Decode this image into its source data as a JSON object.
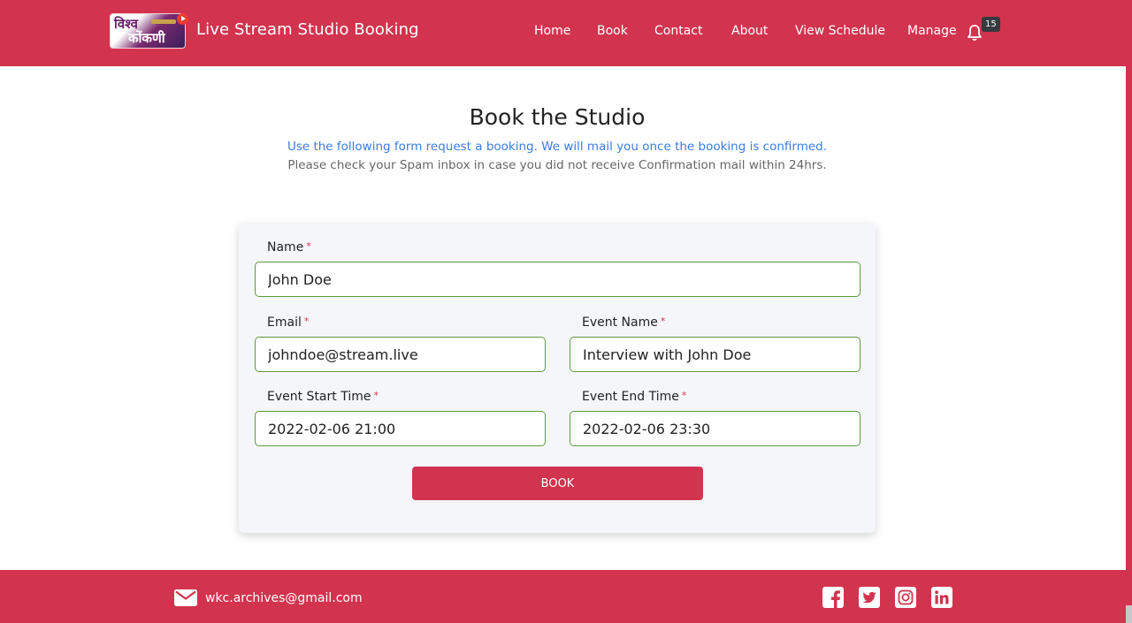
{
  "header": {
    "logo_line1": "विश्व",
    "logo_line2": "कोंकणी",
    "brand": "Live Stream Studio Booking",
    "nav": [
      {
        "label": "Home"
      },
      {
        "label": "Book"
      },
      {
        "label": "Contact"
      },
      {
        "label": "About"
      },
      {
        "label": "View Schedule"
      },
      {
        "label": "Manage"
      }
    ],
    "notifications_icon": "bell-icon",
    "notifications_count": "15"
  },
  "page": {
    "title": "Book the Studio",
    "subtitle": "Use the following form request a booking. We will mail you once the booking is confirmed.",
    "note": "Please check your Spam inbox in case you did not receive Confirmation mail within 24hrs."
  },
  "form": {
    "required_mark": "*",
    "name": {
      "label": "Name",
      "value": "John Doe"
    },
    "email": {
      "label": "Email",
      "value": "johndoe@stream.live"
    },
    "event_name": {
      "label": "Event Name",
      "value": "Interview with John Doe"
    },
    "start_time": {
      "label": "Event Start Time",
      "value": "2022-02-06 21:00"
    },
    "end_time": {
      "label": "Event End Time",
      "value": "2022-02-06 23:30"
    },
    "submit_label": "BOOK"
  },
  "footer": {
    "email_icon": "envelope-icon",
    "email": "wkc.archives@gmail.com",
    "social": [
      "facebook-icon",
      "twitter-icon",
      "instagram-icon",
      "linkedin-icon"
    ]
  },
  "colors": {
    "brand": "#d2334e",
    "link_blue": "#3a7ce0",
    "input_border": "#5a9a3a"
  }
}
